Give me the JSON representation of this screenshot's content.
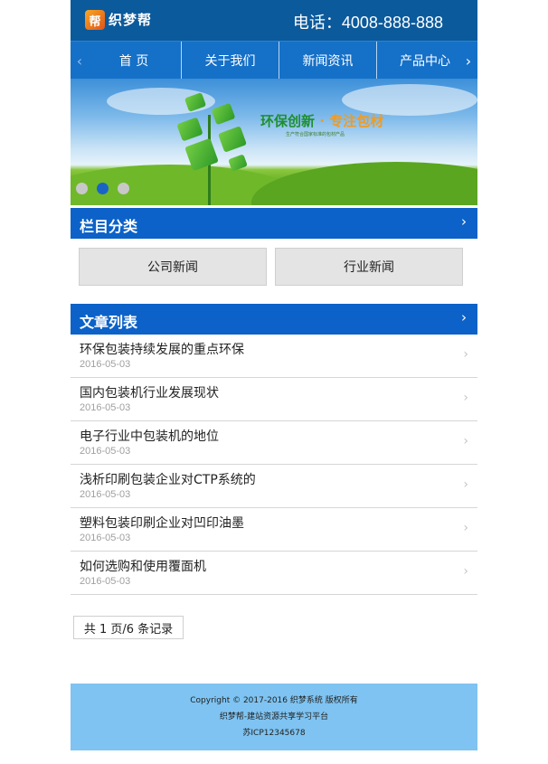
{
  "header": {
    "logo_text": "织梦帮",
    "logo_mark": "帮",
    "phone": "电话：4008-888-888"
  },
  "nav": {
    "items": [
      "首 页",
      "关于我们",
      "新闻资讯",
      "产品中心"
    ],
    "left_arrow_icon": "chevron-left-icon",
    "right_arrow_icon": "chevron-right-icon"
  },
  "banner": {
    "slogan_main": "环保创新",
    "slogan_accent": "专注包材",
    "slogan_sub": "生产符合国家标准的包材产品",
    "dots": 3,
    "active_dot": 2
  },
  "categories": {
    "title": "栏目分类",
    "items": [
      "公司新闻",
      "行业新闻"
    ]
  },
  "articles": {
    "title": "文章列表",
    "items": [
      {
        "title": "环保包装持续发展的重点环保",
        "date": "2016-05-03"
      },
      {
        "title": "国内包装机行业发展现状",
        "date": "2016-05-03"
      },
      {
        "title": "电子行业中包装机的地位",
        "date": "2016-05-03"
      },
      {
        "title": "浅析印刷包装企业对CTP系统的",
        "date": "2016-05-03"
      },
      {
        "title": "塑料包装印刷企业对凹印油墨",
        "date": "2016-05-03"
      },
      {
        "title": "如何选购和使用覆面机",
        "date": "2016-05-03"
      }
    ]
  },
  "pager": {
    "text": "共 1 页/6 条记录"
  },
  "footer": {
    "line1": "Copyright © 2017-2016 织梦系统 版权所有",
    "line2": "织梦帮-建站资源共享学习平台",
    "line3": "苏ICP12345678"
  },
  "colors": {
    "header_bg": "#0b5a9c",
    "nav_bg": "#1570c8",
    "section_bar_bg": "#0c62c8",
    "footer_bg": "#7ec3f1",
    "active_dot": "#1a64c8"
  }
}
